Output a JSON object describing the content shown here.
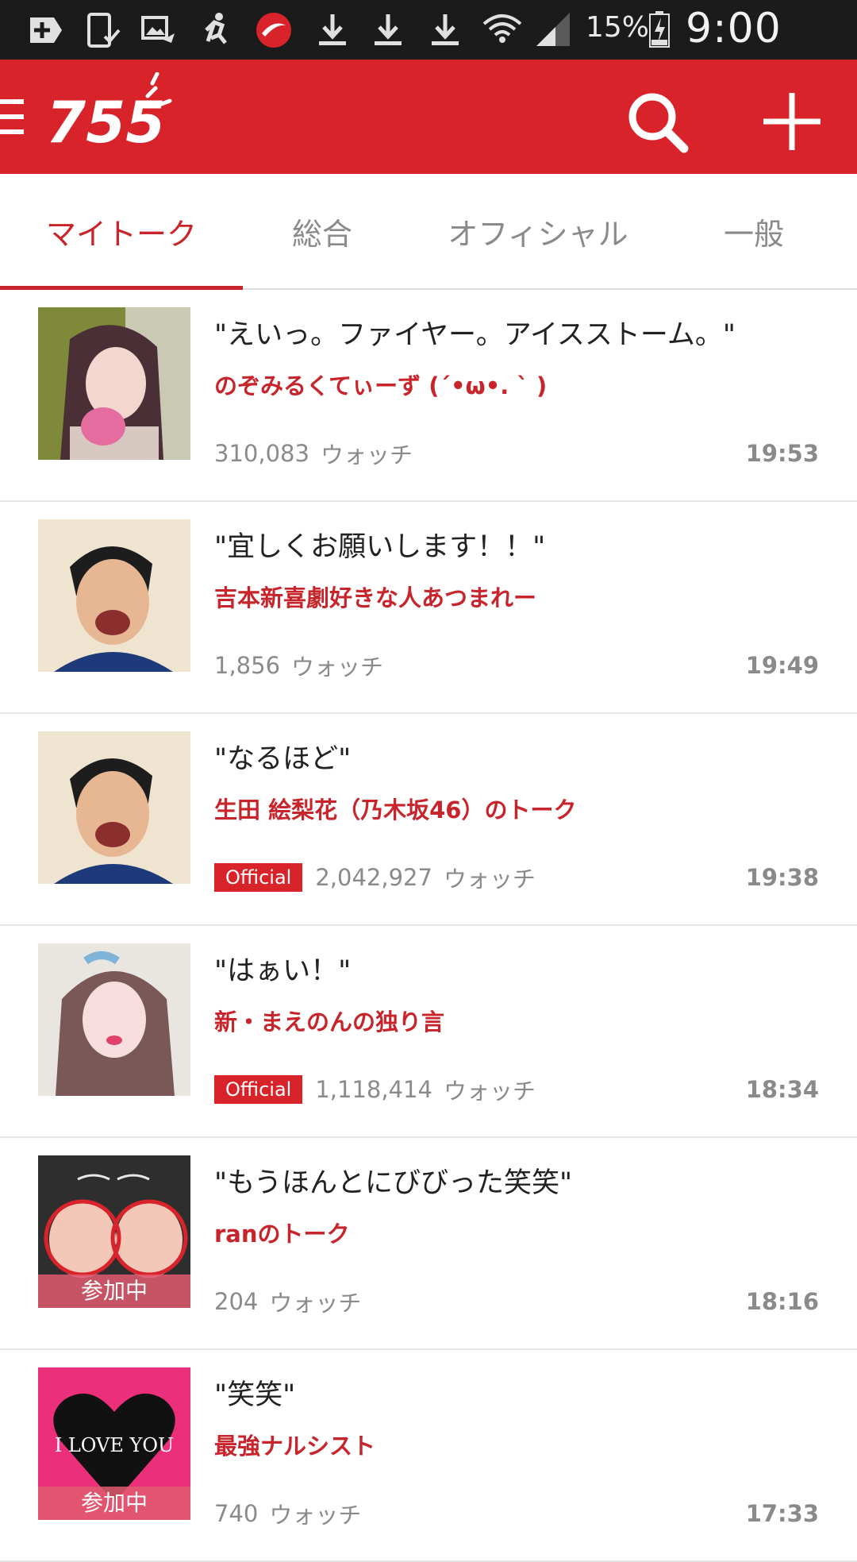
{
  "status_bar": {
    "battery": "15%",
    "time": "9:00 PM",
    "icons": [
      "add-box-icon",
      "phone-check-icon",
      "photo-share-icon",
      "running-man-icon",
      "trend-micro-icon",
      "download-icon",
      "download-icon",
      "download-icon",
      "wifi-icon",
      "signal-icon",
      "battery-charging-icon"
    ]
  },
  "app_bar": {
    "logo": "755",
    "icons": [
      "menu-icon",
      "search-icon",
      "plus-icon"
    ],
    "color": "#d9232a"
  },
  "tabs": [
    {
      "label": "マイトーク",
      "active": true
    },
    {
      "label": "総合",
      "active": false
    },
    {
      "label": "オフィシャル",
      "active": false
    },
    {
      "label": "一般",
      "active": false
    }
  ],
  "watch_label": "ウォッチ",
  "official_label": "Official",
  "joining_label": "参加中",
  "rows": [
    {
      "message": "\"えいっ。ファイヤー。アイスストーム。\"",
      "talk": "のぞみるくてぃーず (´•ω•. ` )",
      "count": "310,083",
      "time": "19:53",
      "official": false,
      "joining": false
    },
    {
      "message": "\"宜しくお願いします！！\"",
      "talk": "吉本新喜劇好きな人あつまれー",
      "count": "1,856",
      "time": "19:49",
      "official": false,
      "joining": false
    },
    {
      "message": "\"なるほど\"",
      "talk": "生田 絵梨花（乃木坂46）のトーク",
      "count": "2,042,927",
      "time": "19:38",
      "official": true,
      "joining": false
    },
    {
      "message": "\"はぁい！\"",
      "talk": "新・まえのんの独り言",
      "count": "1,118,414",
      "time": "18:34",
      "official": true,
      "joining": false
    },
    {
      "message": "\"もうほんとにびびった笑笑\"",
      "talk": "ranのトーク",
      "count": "204",
      "time": "18:16",
      "official": false,
      "joining": true
    },
    {
      "message": "\"笑笑\"",
      "talk": "最強ナルシスト",
      "count": "740",
      "time": "17:33",
      "official": false,
      "joining": true,
      "thumb_text": "I LOVE YOU"
    }
  ]
}
